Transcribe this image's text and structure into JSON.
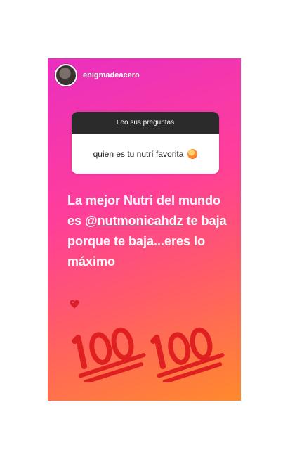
{
  "story": {
    "username": "enigmadeacero",
    "question_sticker": {
      "title": "Leo sus preguntas",
      "question": "quien es tu nutrí favorita"
    },
    "answer": {
      "before_mention": "La mejor Nutri del mundo es ",
      "mention": "@nutmonicahdz",
      "after_mention": " te baja porque te baja...eres lo máximo"
    },
    "stickers": [
      "heart-emoji",
      "100-emoji",
      "100-emoji"
    ],
    "colors": {
      "gradient_top": "#ea2fc0",
      "gradient_bottom": "#ff8a2c",
      "sticker_header": "#2b2b2b"
    }
  }
}
